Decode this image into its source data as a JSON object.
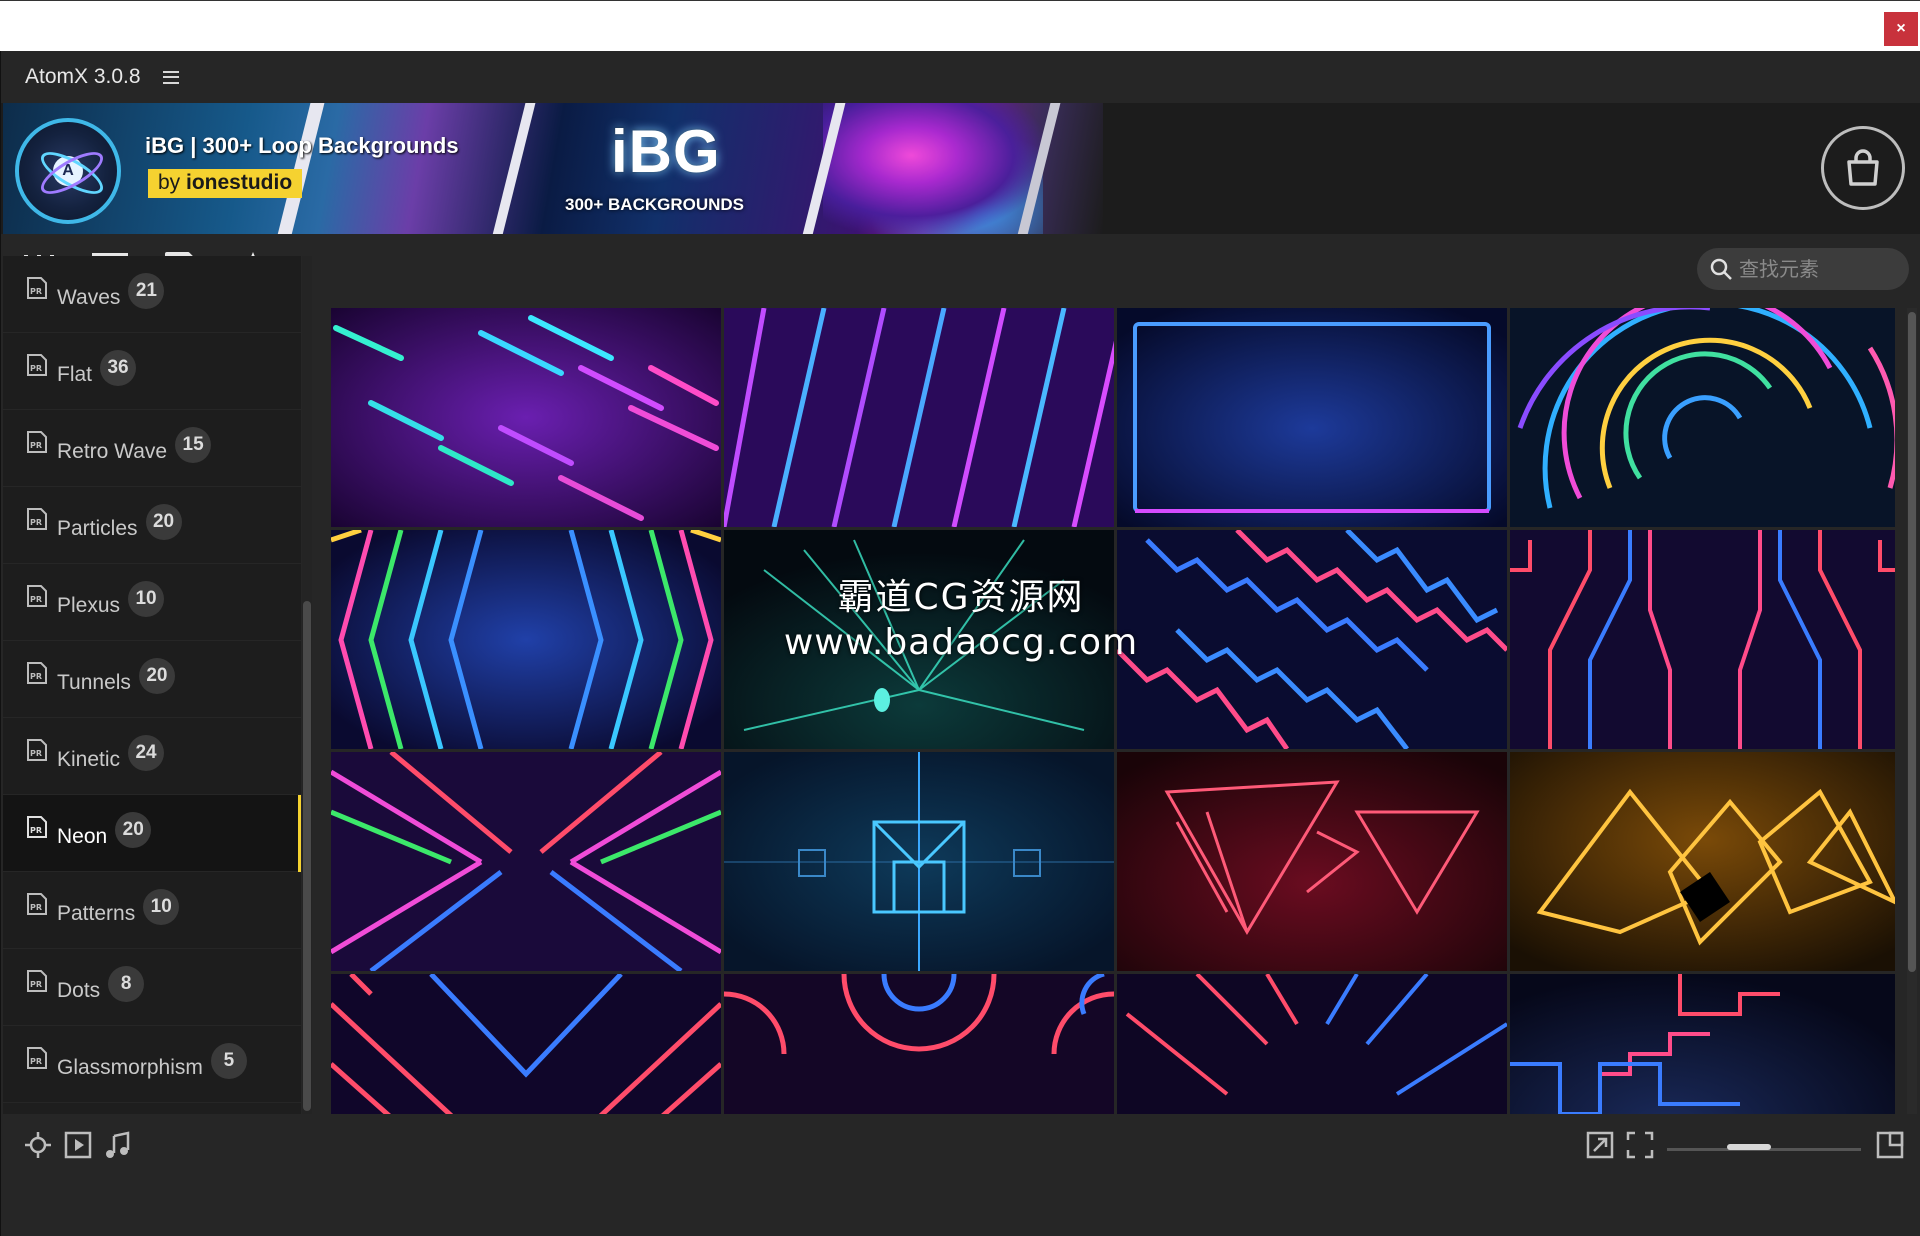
{
  "window": {
    "close_label": "×"
  },
  "app": {
    "title": "AtomX 3.0.8"
  },
  "banner": {
    "title": "iBG | 300+ Loop Backgrounds",
    "by_prefix": "by ",
    "by_author": "ionestudio",
    "logo_letter": "A",
    "promo_title": "iBG",
    "promo_subtitle": "300+ BACKGROUNDS"
  },
  "toolbar": {
    "icons": [
      "sliders-icon",
      "list-view-icon",
      "media-file-icon",
      "favorites-star-icon"
    ],
    "search_placeholder": "查找元素"
  },
  "sidebar": {
    "active": "Neon",
    "categories": [
      {
        "label": "Waves",
        "count": "21"
      },
      {
        "label": "Flat",
        "count": "36"
      },
      {
        "label": "Retro Wave",
        "count": "15"
      },
      {
        "label": "Particles",
        "count": "20"
      },
      {
        "label": "Plexus",
        "count": "10"
      },
      {
        "label": "Tunnels",
        "count": "20"
      },
      {
        "label": "Kinetic",
        "count": "24"
      },
      {
        "label": "Neon",
        "count": "20"
      },
      {
        "label": "Patterns",
        "count": "10"
      },
      {
        "label": "Dots",
        "count": "8"
      },
      {
        "label": "Glassmorphism",
        "count": "5"
      }
    ]
  },
  "grid": {
    "thumbnails": [
      "neon-diagonal-dashes",
      "neon-diagonal-stripes",
      "neon-frame",
      "neon-rings",
      "neon-chevrons",
      "neon-warp-burst",
      "neon-zigzag",
      "neon-tunnel-lines",
      "neon-x-lines",
      "neon-cube",
      "neon-red-pyramids",
      "neon-gold-pyramids",
      "neon-v-lines",
      "neon-arches",
      "neon-rays",
      "neon-steps"
    ]
  },
  "watermark": {
    "line1": "霸道CG资源网",
    "line2": "www.badaocg.com"
  },
  "bottombar": {
    "left_icons": [
      "plugin-icon",
      "play-box-icon",
      "music-note-icon"
    ],
    "right_icons": [
      "export-icon",
      "fit-icon",
      "fullscreen-icon"
    ],
    "thumbnail_size": 0.4
  },
  "colors": {
    "accent": "#f5d230",
    "background": "#262626",
    "sidebar": "#1e1e1e"
  }
}
